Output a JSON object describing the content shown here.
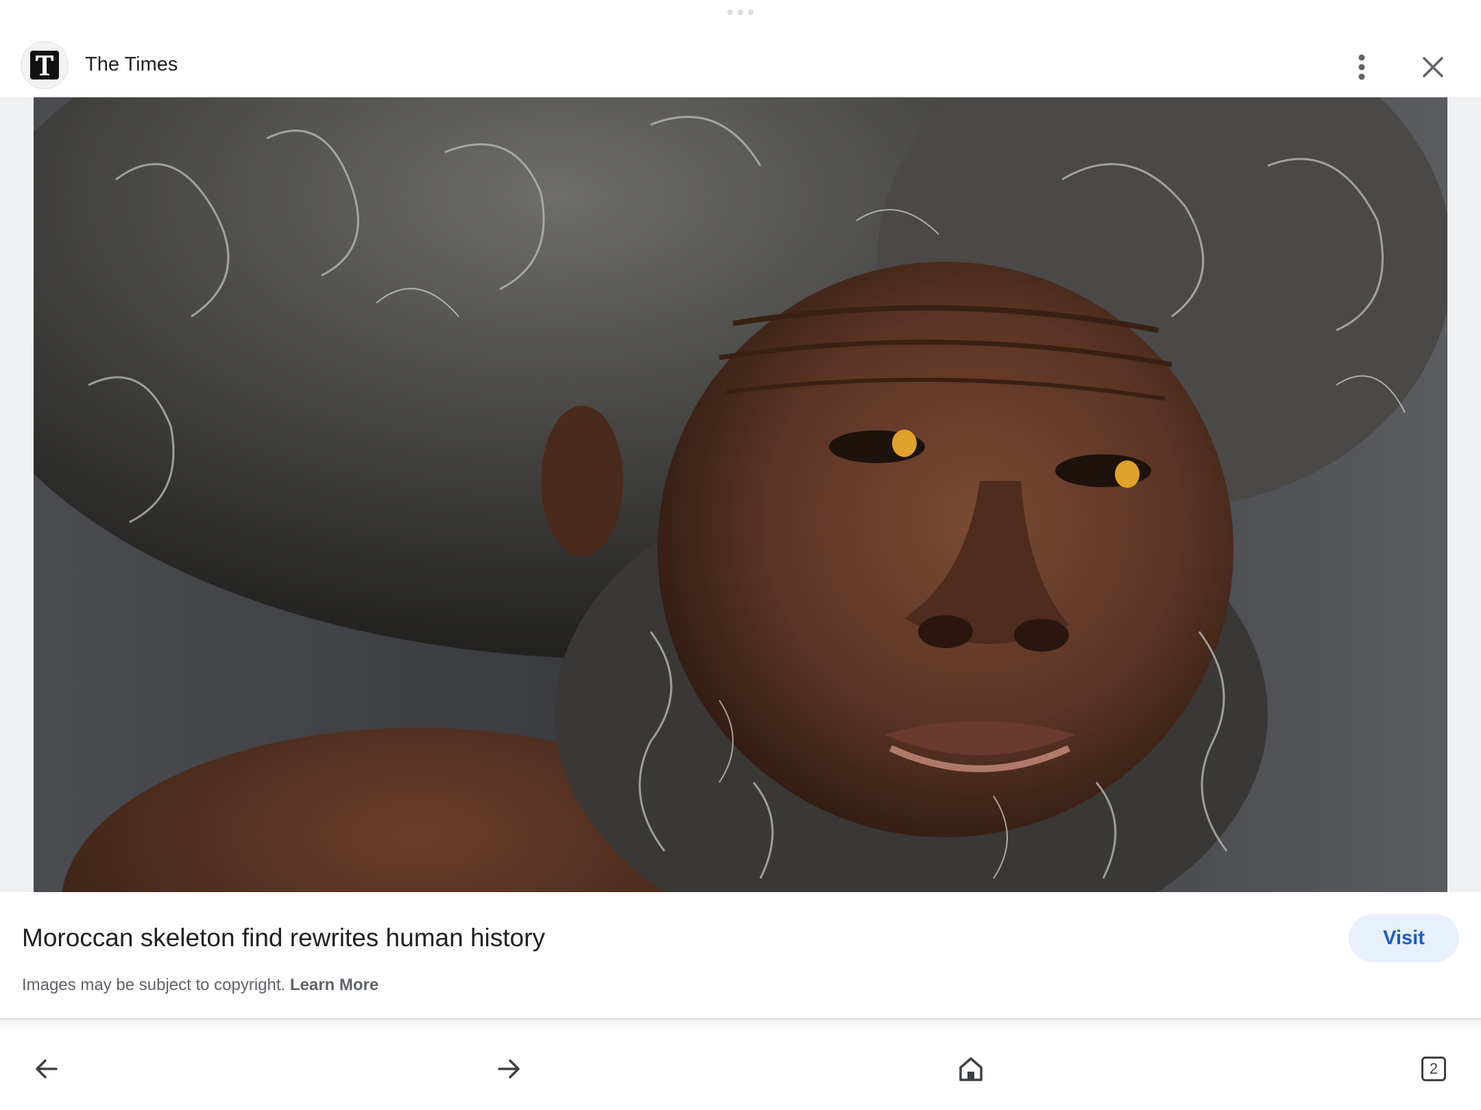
{
  "source": {
    "logo_letter": "T",
    "name": "The Times"
  },
  "header_icons": {
    "menu": "more-vert-icon",
    "close": "close-icon"
  },
  "image": {
    "subject": "portrait-photo",
    "palette": {
      "background": "#3d3f44",
      "skin": "#5a3626",
      "hair": "#8e8f8c",
      "eye": "#e0a22a"
    }
  },
  "caption": {
    "title": "Moroccan skeleton find rewrites human history",
    "visit_label": "Visit",
    "copyright_text": "Images may be subject to copyright.",
    "learn_more_label": "Learn More"
  },
  "bottom_nav": {
    "back_icon": "arrow-back-icon",
    "forward_icon": "arrow-forward-icon",
    "home_icon": "home-icon",
    "tabs_icon": "tab-switcher-icon",
    "tab_count": "2"
  },
  "colors": {
    "accent": "#1a5cc8",
    "accent_bg": "#e8f0fe",
    "text_primary": "#202124",
    "text_secondary": "#5f6368"
  }
}
